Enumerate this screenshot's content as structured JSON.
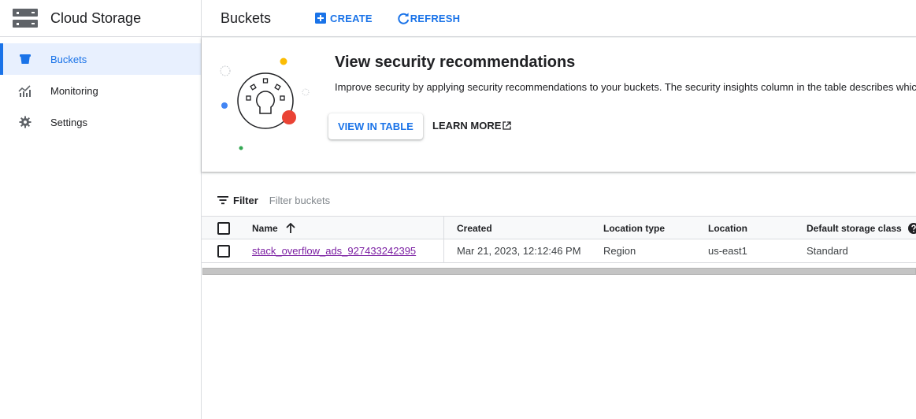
{
  "app": {
    "title": "Cloud Storage"
  },
  "sidebar": {
    "items": [
      {
        "label": "Buckets",
        "icon": "bucket-icon",
        "active": true
      },
      {
        "label": "Monitoring",
        "icon": "monitoring-icon",
        "active": false
      },
      {
        "label": "Settings",
        "icon": "gear-icon",
        "active": false
      }
    ]
  },
  "header": {
    "title": "Buckets",
    "create_label": "CREATE",
    "refresh_label": "REFRESH"
  },
  "banner": {
    "title": "View security recommendations",
    "text": "Improve security by applying security recommendations to your buckets. The security insights column in the table describes whic",
    "primary_button": "VIEW IN TABLE",
    "learn_more": "LEARN MORE"
  },
  "filter": {
    "label": "Filter",
    "placeholder": "Filter buckets"
  },
  "table": {
    "columns": [
      "Name",
      "Created",
      "Location type",
      "Location",
      "Default storage class"
    ],
    "sort_column": "Name",
    "sort_direction": "ascending",
    "rows": [
      {
        "name": "stack_overflow_ads_927433242395",
        "created": "Mar 21, 2023, 12:12:46 PM",
        "location_type": "Region",
        "location": "us-east1",
        "storage_class": "Standard"
      }
    ]
  },
  "colors": {
    "accent": "#1a73e8",
    "active_bg": "#e8f0fe",
    "visited_link": "#7b1fa2"
  }
}
